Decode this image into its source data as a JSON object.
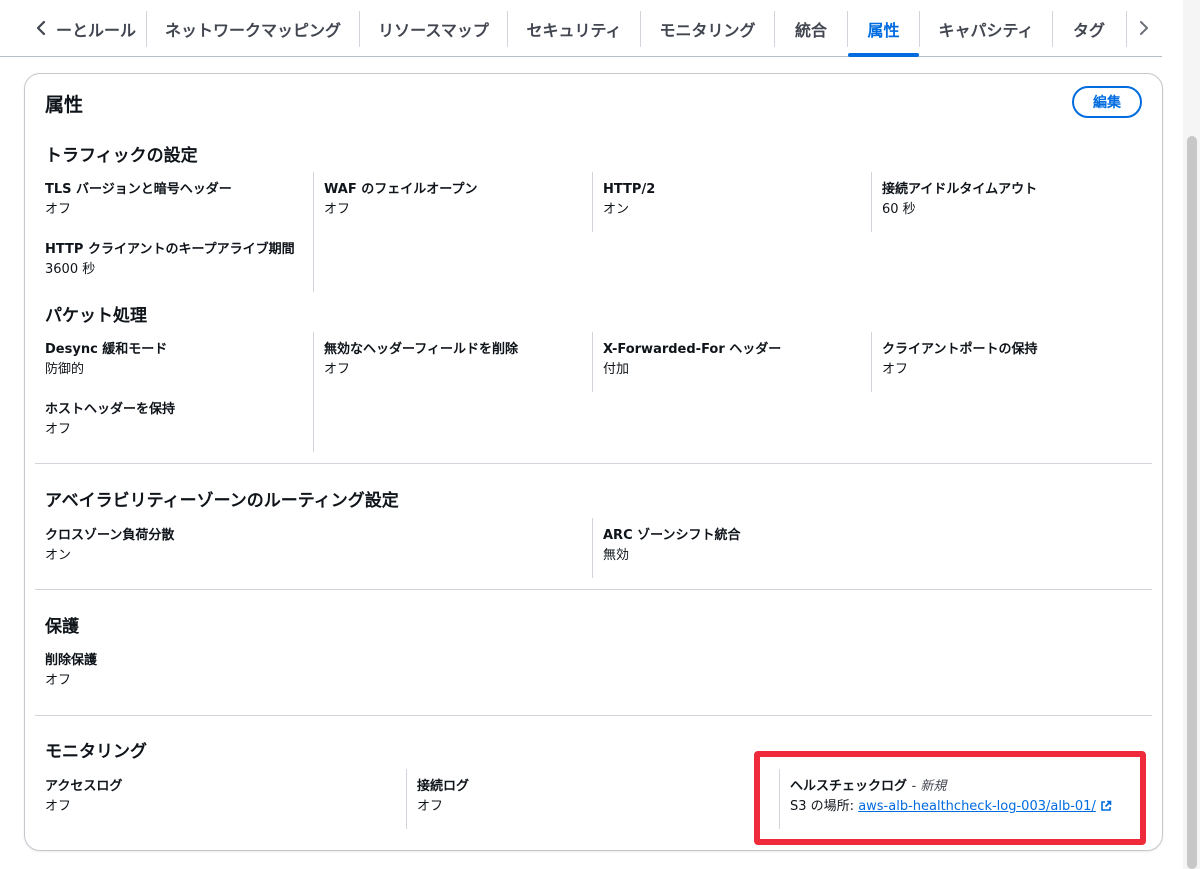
{
  "tabs": {
    "items": [
      {
        "label": "ーとルール"
      },
      {
        "label": "ネットワークマッピング"
      },
      {
        "label": "リソースマップ"
      },
      {
        "label": "セキュリティ"
      },
      {
        "label": "モニタリング"
      },
      {
        "label": "統合"
      },
      {
        "label": "属性",
        "active": true
      },
      {
        "label": "キャパシティ"
      },
      {
        "label": "タグ"
      }
    ],
    "prev_icon": "chevron-left-icon",
    "next_icon": "chevron-right-icon"
  },
  "panel": {
    "title": "属性",
    "edit_label": "編集"
  },
  "traffic": {
    "title": "トラフィックの設定",
    "items": [
      {
        "label": "TLS バージョンと暗号ヘッダー",
        "value": "オフ"
      },
      {
        "label": "WAF のフェイルオープン",
        "value": "オフ"
      },
      {
        "label": "HTTP/2",
        "value": "オン"
      },
      {
        "label": "接続アイドルタイムアウト",
        "value": "60 秒"
      },
      {
        "label": "HTTP クライアントのキープアライブ期間",
        "value": "3600 秒"
      }
    ]
  },
  "packet": {
    "title": "パケット処理",
    "items": [
      {
        "label": "Desync 緩和モード",
        "value": "防御的"
      },
      {
        "label": "無効なヘッダーフィールドを削除",
        "value": "オフ"
      },
      {
        "label": "X-Forwarded-For ヘッダー",
        "value": "付加"
      },
      {
        "label": "クライアントポートの保持",
        "value": "オフ"
      },
      {
        "label": "ホストヘッダーを保持",
        "value": "オフ"
      }
    ]
  },
  "az": {
    "title": "アベイラビリティーゾーンのルーティング設定",
    "items": [
      {
        "label": "クロスゾーン負荷分散",
        "value": "オン"
      },
      {
        "label": "ARC ゾーンシフト統合",
        "value": "無効"
      }
    ]
  },
  "protection": {
    "title": "保護",
    "items": [
      {
        "label": "削除保護",
        "value": "オフ"
      }
    ]
  },
  "monitoring": {
    "title": "モニタリング",
    "access_log": {
      "label": "アクセスログ",
      "value": "オフ"
    },
    "connection_log": {
      "label": "接続ログ",
      "value": "オフ"
    },
    "health_check_log": {
      "label": "ヘルスチェックログ",
      "tag": "- 新規",
      "s3_prefix": "S3 の場所:",
      "s3_link": "aws-alb-healthcheck-log-003/alb-01/",
      "link_icon": "external-link-icon"
    }
  },
  "colors": {
    "accent": "#006ce0",
    "highlight": "#ef2b3b",
    "divider": "#d1d5db"
  }
}
